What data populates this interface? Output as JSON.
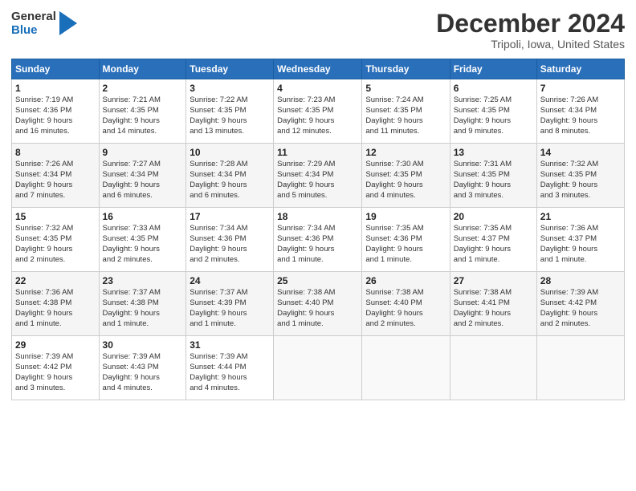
{
  "header": {
    "logo_line1": "General",
    "logo_line2": "Blue",
    "month_title": "December 2024",
    "location": "Tripoli, Iowa, United States"
  },
  "weekdays": [
    "Sunday",
    "Monday",
    "Tuesday",
    "Wednesday",
    "Thursday",
    "Friday",
    "Saturday"
  ],
  "weeks": [
    [
      {
        "day": "1",
        "info": "Sunrise: 7:19 AM\nSunset: 4:36 PM\nDaylight: 9 hours\nand 16 minutes."
      },
      {
        "day": "2",
        "info": "Sunrise: 7:21 AM\nSunset: 4:35 PM\nDaylight: 9 hours\nand 14 minutes."
      },
      {
        "day": "3",
        "info": "Sunrise: 7:22 AM\nSunset: 4:35 PM\nDaylight: 9 hours\nand 13 minutes."
      },
      {
        "day": "4",
        "info": "Sunrise: 7:23 AM\nSunset: 4:35 PM\nDaylight: 9 hours\nand 12 minutes."
      },
      {
        "day": "5",
        "info": "Sunrise: 7:24 AM\nSunset: 4:35 PM\nDaylight: 9 hours\nand 11 minutes."
      },
      {
        "day": "6",
        "info": "Sunrise: 7:25 AM\nSunset: 4:35 PM\nDaylight: 9 hours\nand 9 minutes."
      },
      {
        "day": "7",
        "info": "Sunrise: 7:26 AM\nSunset: 4:34 PM\nDaylight: 9 hours\nand 8 minutes."
      }
    ],
    [
      {
        "day": "8",
        "info": "Sunrise: 7:26 AM\nSunset: 4:34 PM\nDaylight: 9 hours\nand 7 minutes."
      },
      {
        "day": "9",
        "info": "Sunrise: 7:27 AM\nSunset: 4:34 PM\nDaylight: 9 hours\nand 6 minutes."
      },
      {
        "day": "10",
        "info": "Sunrise: 7:28 AM\nSunset: 4:34 PM\nDaylight: 9 hours\nand 6 minutes."
      },
      {
        "day": "11",
        "info": "Sunrise: 7:29 AM\nSunset: 4:34 PM\nDaylight: 9 hours\nand 5 minutes."
      },
      {
        "day": "12",
        "info": "Sunrise: 7:30 AM\nSunset: 4:35 PM\nDaylight: 9 hours\nand 4 minutes."
      },
      {
        "day": "13",
        "info": "Sunrise: 7:31 AM\nSunset: 4:35 PM\nDaylight: 9 hours\nand 3 minutes."
      },
      {
        "day": "14",
        "info": "Sunrise: 7:32 AM\nSunset: 4:35 PM\nDaylight: 9 hours\nand 3 minutes."
      }
    ],
    [
      {
        "day": "15",
        "info": "Sunrise: 7:32 AM\nSunset: 4:35 PM\nDaylight: 9 hours\nand 2 minutes."
      },
      {
        "day": "16",
        "info": "Sunrise: 7:33 AM\nSunset: 4:35 PM\nDaylight: 9 hours\nand 2 minutes."
      },
      {
        "day": "17",
        "info": "Sunrise: 7:34 AM\nSunset: 4:36 PM\nDaylight: 9 hours\nand 2 minutes."
      },
      {
        "day": "18",
        "info": "Sunrise: 7:34 AM\nSunset: 4:36 PM\nDaylight: 9 hours\nand 1 minute."
      },
      {
        "day": "19",
        "info": "Sunrise: 7:35 AM\nSunset: 4:36 PM\nDaylight: 9 hours\nand 1 minute."
      },
      {
        "day": "20",
        "info": "Sunrise: 7:35 AM\nSunset: 4:37 PM\nDaylight: 9 hours\nand 1 minute."
      },
      {
        "day": "21",
        "info": "Sunrise: 7:36 AM\nSunset: 4:37 PM\nDaylight: 9 hours\nand 1 minute."
      }
    ],
    [
      {
        "day": "22",
        "info": "Sunrise: 7:36 AM\nSunset: 4:38 PM\nDaylight: 9 hours\nand 1 minute."
      },
      {
        "day": "23",
        "info": "Sunrise: 7:37 AM\nSunset: 4:38 PM\nDaylight: 9 hours\nand 1 minute."
      },
      {
        "day": "24",
        "info": "Sunrise: 7:37 AM\nSunset: 4:39 PM\nDaylight: 9 hours\nand 1 minute."
      },
      {
        "day": "25",
        "info": "Sunrise: 7:38 AM\nSunset: 4:40 PM\nDaylight: 9 hours\nand 1 minute."
      },
      {
        "day": "26",
        "info": "Sunrise: 7:38 AM\nSunset: 4:40 PM\nDaylight: 9 hours\nand 2 minutes."
      },
      {
        "day": "27",
        "info": "Sunrise: 7:38 AM\nSunset: 4:41 PM\nDaylight: 9 hours\nand 2 minutes."
      },
      {
        "day": "28",
        "info": "Sunrise: 7:39 AM\nSunset: 4:42 PM\nDaylight: 9 hours\nand 2 minutes."
      }
    ],
    [
      {
        "day": "29",
        "info": "Sunrise: 7:39 AM\nSunset: 4:42 PM\nDaylight: 9 hours\nand 3 minutes."
      },
      {
        "day": "30",
        "info": "Sunrise: 7:39 AM\nSunset: 4:43 PM\nDaylight: 9 hours\nand 4 minutes."
      },
      {
        "day": "31",
        "info": "Sunrise: 7:39 AM\nSunset: 4:44 PM\nDaylight: 9 hours\nand 4 minutes."
      },
      {
        "day": "",
        "info": ""
      },
      {
        "day": "",
        "info": ""
      },
      {
        "day": "",
        "info": ""
      },
      {
        "day": "",
        "info": ""
      }
    ]
  ]
}
